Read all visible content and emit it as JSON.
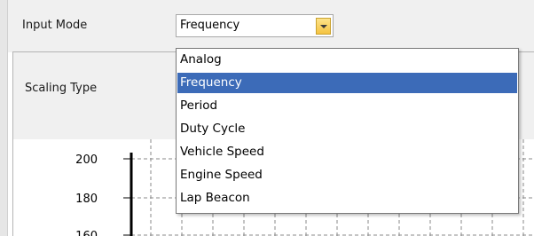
{
  "input_mode": {
    "label": "Input Mode",
    "selected": "Frequency",
    "options": [
      "Analog",
      "Frequency",
      "Period",
      "Duty Cycle",
      "Vehicle Speed",
      "Engine Speed",
      "Lap Beacon"
    ],
    "selected_index": 1
  },
  "scaling_type": {
    "label": "Scaling Type"
  },
  "chart": {
    "y_ticks": [
      "200",
      "180",
      "160"
    ]
  },
  "colors": {
    "selection": "#3c6bb8",
    "dropdown_button": "#f5c342",
    "panel": "#f0f0f0"
  }
}
